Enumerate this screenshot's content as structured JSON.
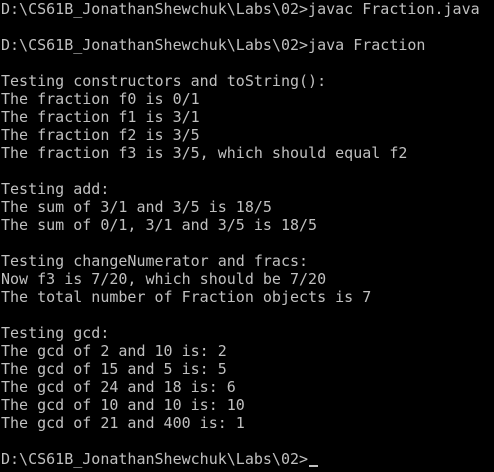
{
  "terminal": {
    "lines": [
      "D:\\CS61B_JonathanShewchuk\\Labs\\02>javac Fraction.java",
      "",
      "D:\\CS61B_JonathanShewchuk\\Labs\\02>java Fraction",
      "",
      "Testing constructors and toString():",
      "The fraction f0 is 0/1",
      "The fraction f1 is 3/1",
      "The fraction f2 is 3/5",
      "The fraction f3 is 3/5, which should equal f2",
      "",
      "Testing add:",
      "The sum of 3/1 and 3/5 is 18/5",
      "The sum of 0/1, 3/1 and 3/5 is 18/5",
      "",
      "Testing changeNumerator and fracs:",
      "Now f3 is 7/20, which should be 7/20",
      "The total number of Fraction objects is 7",
      "",
      "Testing gcd:",
      "The gcd of 2 and 10 is: 2",
      "The gcd of 15 and 5 is: 5",
      "The gcd of 24 and 18 is: 6",
      "The gcd of 10 and 10 is: 10",
      "The gcd of 21 and 400 is: 1",
      "",
      "D:\\CS61B_JonathanShewchuk\\Labs\\02>"
    ]
  },
  "colors": {
    "background": "#000000",
    "text": "#c0c0c0"
  }
}
